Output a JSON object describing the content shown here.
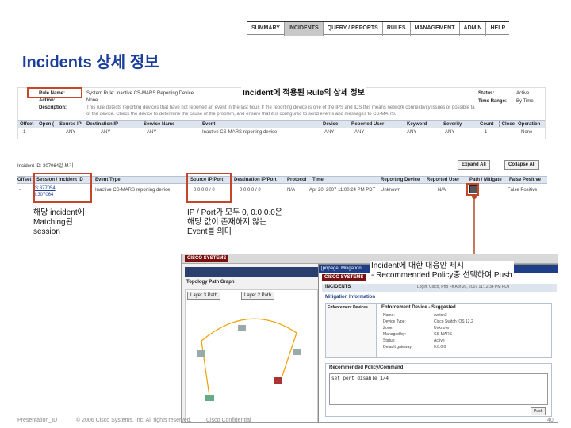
{
  "nav": {
    "items": [
      {
        "label": "SUMMARY",
        "active": false
      },
      {
        "label": "INCIDENTS",
        "active": true
      },
      {
        "label": "QUERY / REPORTS",
        "active": false
      },
      {
        "label": "RULES",
        "active": false
      },
      {
        "label": "MANAGEMENT",
        "active": false
      },
      {
        "label": "ADMIN",
        "active": false
      },
      {
        "label": "HELP",
        "active": false
      }
    ]
  },
  "title": "Incidents 상세 정보",
  "rule_panel": {
    "callout": "Incident에 적용된 Rule의 상세 정보",
    "rule_name_label": "Rule Name:",
    "rule_name_value": "System Rule: Inactive CS-MARS Reporting Device",
    "action_label": "Action:",
    "action_value": "None",
    "description_label": "Description:",
    "description_value": "This rule detects reporting devices that have not reported an event in the last hour. If the reporting device is one of the IPS and IDS this means network connectivity issues or possible tamper",
    "description_value2": "of the device. Check the device to determine the cause of the problem, and ensure that it is configured to send events and messages to CS-MARS.",
    "status_label": "Status:",
    "status_value": "Active",
    "time_range_label": "Time Range:",
    "time_range_value": "By Time",
    "columns": [
      "Offset",
      "Open (",
      "Source IP",
      "Destination IP",
      "Service Name",
      "Event",
      "Device",
      "Reported User",
      "Keyword",
      "Severity",
      "Count",
      ") Close",
      "Operation"
    ],
    "row": [
      "1",
      "",
      "ANY",
      "ANY",
      "ANY",
      "Inactive CS-MARS reporting device",
      "ANY",
      "ANY",
      "ANY",
      "ANY",
      "1",
      "",
      "None"
    ]
  },
  "incidents": {
    "id_label": "Incident ID: 307064일 보기",
    "expand_all": "Expand All",
    "collapse_all": "Collapse All",
    "columns": [
      "Offset",
      "Session / Incident ID",
      "Event Type",
      "Source IP/Port",
      "Destination IP/Port",
      "Protocol",
      "Time",
      "Reporting Device",
      "Reported User",
      "Path / Mitigate",
      "False Positive"
    ],
    "row": {
      "offset": "-",
      "session": "S:877054",
      "incident": "I:307064",
      "event_type": "Inactive CS-MARS reporting device",
      "source": "0.0.0.0 / 0",
      "destination": "0.0.0.0 / 0",
      "protocol": "N/A",
      "time": "Apr 20, 2007 11:00:24 PM PDT",
      "reporting_device": "Unknown",
      "reported_user": "N/A",
      "false_positive": "False Positive"
    }
  },
  "annotations": {
    "session": "해당 incident에\nMatching된\nsession",
    "ip_port": "IP / Port가 모두 0, 0.0.0.0은\n해당 값이 존재하지 않는\nEvent를 의미",
    "mitigation": "Incident에 대한 대응안 제시\n- Recommended Policy중 선택하여 Push"
  },
  "screenshot": {
    "cisco_logo": "CISCO SYSTEMS",
    "inner_title": "[pnpage] Mitigation",
    "topology_title": "Topology Path Graph",
    "layer3": "Layer 3 Path",
    "layer2": "Layer 2 Path",
    "incidents_tab": "INCIDENTS",
    "login_text": "Login: Cisco, Pnp Fri Apr 20, 2007 11:12:34 PM PDT",
    "mitigation_info": "Mitigation Information",
    "enforcement_devices": "Enforcement Devices",
    "suggested": "Enforcement Device - Suggested",
    "fields": [
      {
        "label": "Name:",
        "value": "switch3"
      },
      {
        "label": "Device Type:",
        "value": "Cisco Switch IOS 12.2"
      },
      {
        "label": "Zone:",
        "value": "Unknown"
      },
      {
        "label": "Managed by:",
        "value": "CS-MARS"
      },
      {
        "label": "Status:",
        "value": "Active"
      },
      {
        "label": "Default gateway:",
        "value": "0.0.0.0"
      }
    ],
    "recommended_policy": "Recommended Policy/Command",
    "command": "set port disable 1/4",
    "push_button": "Push"
  },
  "footer": {
    "left": "Presentation_ID",
    "center": "© 2006 Cisco Systems, Inc. All rights reserved.",
    "confidential": "Cisco Confidential",
    "page": "40"
  }
}
